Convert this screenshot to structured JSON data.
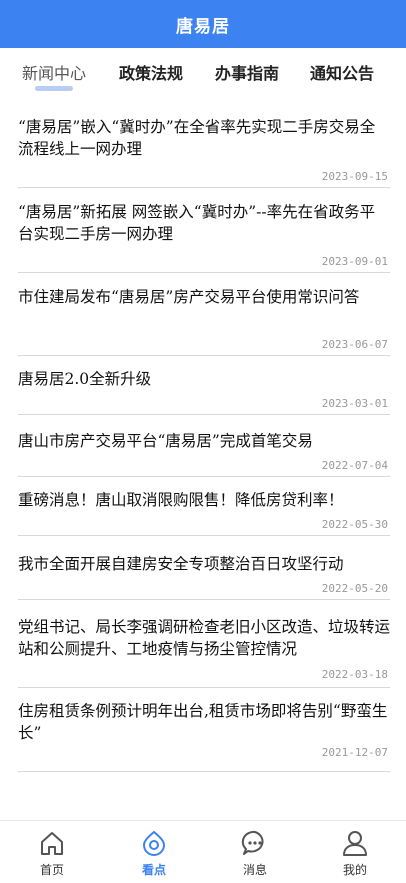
{
  "header": {
    "title": "唐易居"
  },
  "tabs": [
    {
      "label": "新闻中心",
      "active": true
    },
    {
      "label": "政策法规",
      "active": false
    },
    {
      "label": "办事指南",
      "active": false
    },
    {
      "label": "通知公告",
      "active": false
    }
  ],
  "news": [
    {
      "title": "“唐易居”嵌入“冀时办”在全省率先实现二手房交易全流程线上一网办理",
      "date": "2023-09-15"
    },
    {
      "title": "“唐易居”新拓展 网签嵌入“冀时办”--率先在省政务平台实现二手房一网办理",
      "date": "2023-09-01"
    },
    {
      "title": "市住建局发布“唐易居”房产交易平台使用常识问答",
      "date": "2023-06-07"
    },
    {
      "title": "唐易居2.0全新升级",
      "date": "2023-03-01"
    },
    {
      "title": "唐山市房产交易平台“唐易居”完成首笔交易",
      "date": "2022-07-04"
    },
    {
      "title": "重磅消息！唐山取消限购限售！降低房贷利率！",
      "date": "2022-05-30"
    },
    {
      "title": "我市全面开展自建房安全专项整治百日攻坚行动",
      "date": "2022-05-20"
    },
    {
      "title": "党组书记、局长李强调研检查老旧小区改造、垃圾转运站和公厕提升、工地疫情与扬尘管控情况",
      "date": "2022-03-18"
    },
    {
      "title": "住房租赁条例预计明年出台,租赁市场即将告别“野蛮生长”",
      "date": "2021-12-07"
    }
  ],
  "tabbar": [
    {
      "label": "首页",
      "icon": "home-icon",
      "active": false
    },
    {
      "label": "看点",
      "icon": "eye-icon",
      "active": true
    },
    {
      "label": "消息",
      "icon": "message-icon",
      "active": false
    },
    {
      "label": "我的",
      "icon": "user-icon",
      "active": false
    }
  ],
  "colors": {
    "accent": "#3c82f0",
    "divider": "#d8d8d8",
    "date": "#999999"
  }
}
